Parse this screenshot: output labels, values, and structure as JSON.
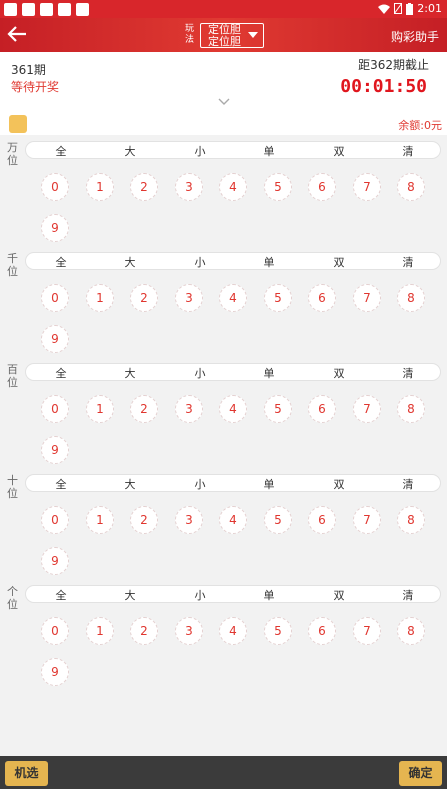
{
  "status_bar": {
    "time": "2:01",
    "icons": [
      "wifi-icon",
      "no-sim-icon",
      "battery-icon"
    ]
  },
  "header": {
    "back_icon": "arrow-left-icon",
    "play_label": "玩法",
    "play_select_line1": "定位胆",
    "play_select_line2": "定位胆",
    "helper": "购彩助手"
  },
  "info": {
    "issue": "361期",
    "status": "等待开奖",
    "deadline": "距362期截止",
    "countdown": "00:01:50"
  },
  "balance": "余额:0元",
  "quick_options": [
    "全",
    "大",
    "小",
    "单",
    "双",
    "清"
  ],
  "numbers": [
    "0",
    "1",
    "2",
    "3",
    "4",
    "5",
    "6",
    "7",
    "8",
    "9"
  ],
  "sections": [
    {
      "label": "万位"
    },
    {
      "label": "千位"
    },
    {
      "label": "百位"
    },
    {
      "label": "十位"
    },
    {
      "label": "个位"
    }
  ],
  "footer": {
    "random": "机选",
    "confirm": "确定"
  },
  "colors": {
    "header": "#d8262b",
    "accent": "#e03a32",
    "button": "#e5b550",
    "footer": "#3b3b3b"
  }
}
